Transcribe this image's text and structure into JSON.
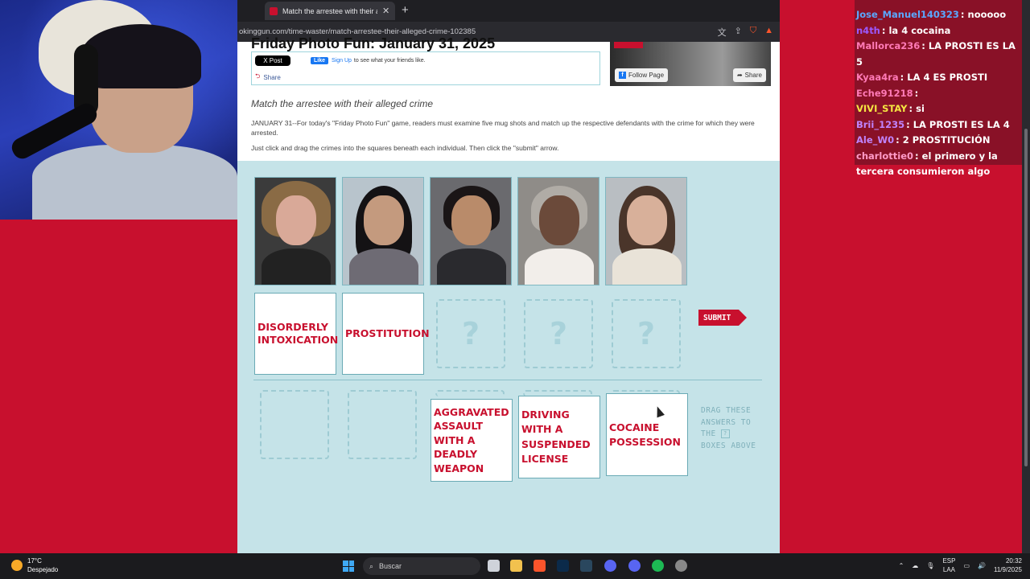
{
  "browser": {
    "tab_title": "Match the arrestee with their alle",
    "url": "okinggun.com/time-waster/match-arrestee-their-alleged-crime-102385"
  },
  "article": {
    "title": "Friday Photo Fun: January 31, 2025",
    "x_post": "X Post",
    "fb_like": "Like",
    "fb_signup": "Sign Up",
    "fb_signup_rest": "to see what your friends like.",
    "share": "Share",
    "fb_follow": "Follow Page",
    "fb_share": "Share",
    "subtitle": "Match the arrestee with their alleged crime",
    "body1": "JANUARY 31--For today's \"Friday Photo Fun\" game, readers must examine five mug shots and match up the respective defendants with the crime for which they were arrested.",
    "body2": "Just click and drag the crimes into the squares beneath each individual. Then click the \"submit\" arrow."
  },
  "game": {
    "placed_answers": [
      "DISORDERLY INTOXICATION",
      "PROSTITUTION"
    ],
    "empty_slot_mark": "?",
    "remaining_answers": [
      "AGGRAVATED ASSAULT WITH A DEADLY WEAPON",
      "DRIVING WITH A SUSPENDED LICENSE",
      "COCAINE POSSESSION"
    ],
    "submit_label": "SUBMIT",
    "instr_pre": "DRAG THESE ANSWERS TO THE",
    "instr_post": "BOXES ABOVE",
    "instr_box": "?"
  },
  "chat": [
    {
      "user": "Jose_Manuel140323",
      "text": "nooooo",
      "color": "#5aa7ff"
    },
    {
      "user": "n4th",
      "text": "la 4 cocaina",
      "color": "#9b59ff"
    },
    {
      "user": "Mallorca236",
      "text": "LA PROSTI ES LA 5",
      "color": "#ff7ab6"
    },
    {
      "user": "Kyaa4ra",
      "text": "LA 4 ES PROSTI",
      "color": "#ff7ab6"
    },
    {
      "user": "Eche91218",
      "text": "",
      "color": "#ff7ab6"
    },
    {
      "user": "VIVI_STAY",
      "text": "si",
      "color": "#f5e642"
    },
    {
      "user": "Brii_1235",
      "text": "LA PROSTI ES LA 4",
      "color": "#c084fc"
    },
    {
      "user": "Ale_W0",
      "text": "2 PROSTITUCIÓN",
      "color": "#c084fc"
    },
    {
      "user": "charlottie0",
      "text": "el primero y la tercera consumieron algo",
      "color": "#ff9bc8"
    }
  ],
  "taskbar": {
    "temp": "17°C",
    "weather": "Despejado",
    "search": "Buscar",
    "lang1": "ESP",
    "lang2": "LAA",
    "time": "20:32",
    "date": "11/9/2025"
  }
}
